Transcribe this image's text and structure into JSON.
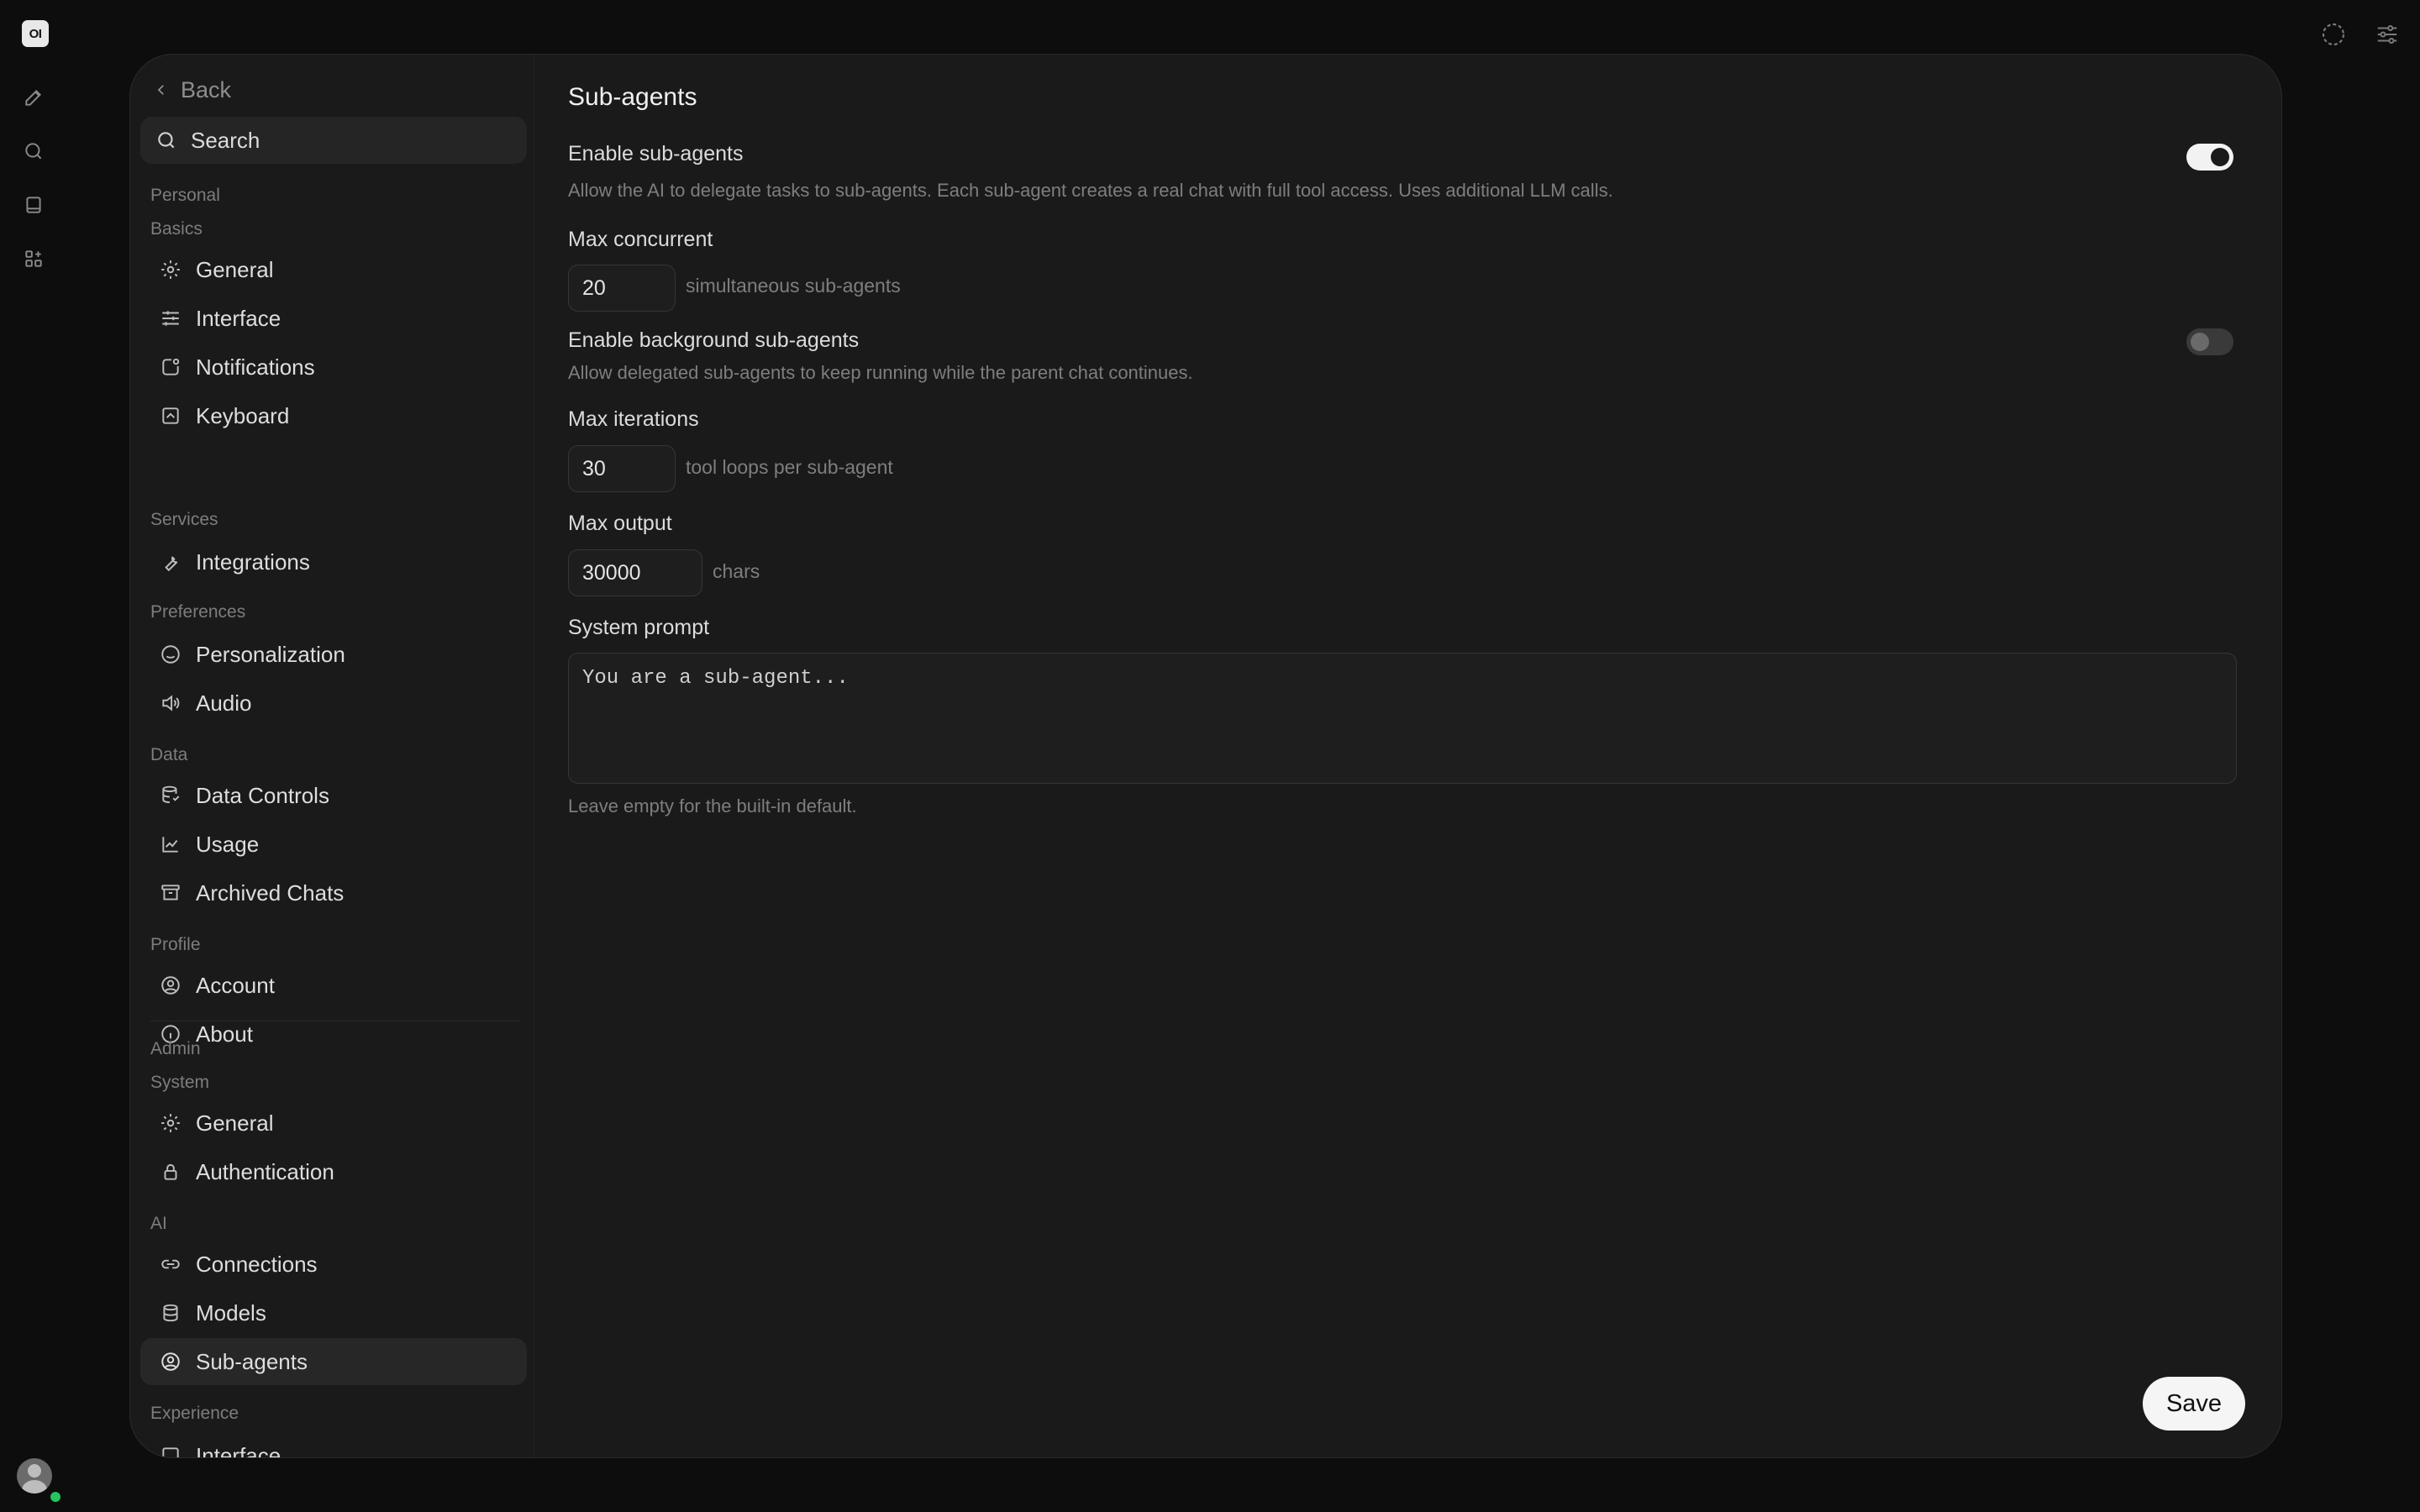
{
  "app": {
    "logo": "OI"
  },
  "sidebar": {
    "back_label": "Back",
    "search_label": "Search",
    "section_personal": "Personal",
    "groups": {
      "basics": "Basics",
      "services": "Services",
      "preferences": "Preferences",
      "data": "Data",
      "profile": "Profile",
      "system": "System",
      "ai": "AI",
      "experience": "Experience"
    },
    "section_admin": "Admin",
    "items": {
      "general": "General",
      "interface": "Interface",
      "notifications": "Notifications",
      "keyboard": "Keyboard",
      "integrations": "Integrations",
      "personalization": "Personalization",
      "audio": "Audio",
      "data_controls": "Data Controls",
      "usage": "Usage",
      "archived_chats": "Archived Chats",
      "account": "Account",
      "about": "About",
      "admin_general": "General",
      "authentication": "Authentication",
      "connections": "Connections",
      "models": "Models",
      "sub_agents": "Sub-agents",
      "experience_interface": "Interface"
    }
  },
  "main": {
    "title": "Sub-agents",
    "enable_sub_agents": {
      "label": "Enable sub-agents",
      "description": "Allow the AI to delegate tasks to sub-agents. Each sub-agent creates a real chat with full tool access. Uses additional LLM calls.",
      "enabled": true
    },
    "max_concurrent": {
      "label": "Max concurrent",
      "value": "20",
      "unit": "simultaneous sub-agents"
    },
    "enable_background": {
      "label": "Enable background sub-agents",
      "description": "Allow delegated sub-agents to keep running while the parent chat continues.",
      "enabled": false
    },
    "max_iterations": {
      "label": "Max iterations",
      "value": "30",
      "unit": "tool loops per sub-agent"
    },
    "max_output": {
      "label": "Max output",
      "value": "30000",
      "unit": "chars"
    },
    "system_prompt": {
      "label": "System prompt",
      "placeholder": "You are a sub-agent...",
      "hint": "Leave empty for the built-in default."
    },
    "save_label": "Save"
  }
}
